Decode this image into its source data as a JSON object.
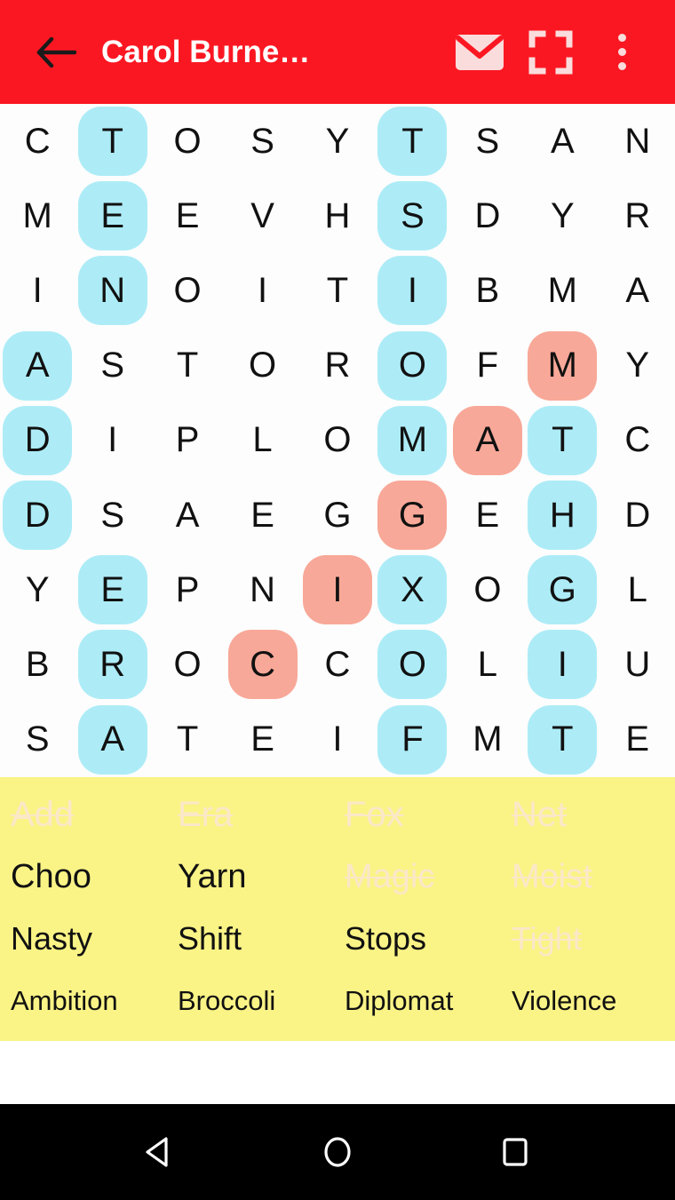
{
  "appbar": {
    "title": "Carol Burne…",
    "back_icon": "arrow-left-icon",
    "mail_icon": "envelope-icon",
    "fullscreen_icon": "fullscreen-icon",
    "overflow_icon": "more-vertical-icon",
    "background_color": "#FB1722",
    "title_color": "#FFFFFF",
    "icon_color": "#FADCDC"
  },
  "grid": {
    "rows": 9,
    "cols": 9,
    "highlight_cyan": "#ADECF7",
    "highlight_pink": "#F8A898",
    "letter_color": "#111111",
    "letters": [
      [
        "C",
        "T",
        "O",
        "S",
        "Y",
        "T",
        "S",
        "A",
        "N"
      ],
      [
        "M",
        "E",
        "E",
        "V",
        "H",
        "S",
        "D",
        "Y",
        "R"
      ],
      [
        "I",
        "N",
        "O",
        "I",
        "T",
        "I",
        "B",
        "M",
        "A"
      ],
      [
        "A",
        "S",
        "T",
        "O",
        "R",
        "O",
        "F",
        "M",
        "Y"
      ],
      [
        "D",
        "I",
        "P",
        "L",
        "O",
        "M",
        "A",
        "T",
        "C"
      ],
      [
        "D",
        "S",
        "A",
        "E",
        "G",
        "G",
        "E",
        "H",
        "D"
      ],
      [
        "Y",
        "E",
        "P",
        "N",
        "I",
        "X",
        "O",
        "G",
        "L"
      ],
      [
        "B",
        "R",
        "O",
        "C",
        "C",
        "O",
        "L",
        "I",
        "U"
      ],
      [
        "S",
        "A",
        "T",
        "E",
        "I",
        "F",
        "M",
        "T",
        "E"
      ]
    ],
    "highlights": [
      [
        "none",
        "cyan",
        "none",
        "none",
        "none",
        "cyan",
        "none",
        "none",
        "none"
      ],
      [
        "none",
        "cyan",
        "none",
        "none",
        "none",
        "cyan",
        "none",
        "none",
        "none"
      ],
      [
        "none",
        "cyan",
        "none",
        "none",
        "none",
        "cyan",
        "none",
        "none",
        "none"
      ],
      [
        "cyan",
        "none",
        "none",
        "none",
        "none",
        "cyan",
        "none",
        "pink",
        "none"
      ],
      [
        "cyan",
        "none",
        "none",
        "none",
        "none",
        "cyan",
        "pink",
        "cyan",
        "none"
      ],
      [
        "cyan",
        "none",
        "none",
        "none",
        "none",
        "pink",
        "none",
        "cyan",
        "none"
      ],
      [
        "none",
        "cyan",
        "none",
        "none",
        "pink",
        "cyan",
        "none",
        "cyan",
        "none"
      ],
      [
        "none",
        "cyan",
        "none",
        "pink",
        "none",
        "cyan",
        "none",
        "cyan",
        "none"
      ],
      [
        "none",
        "cyan",
        "none",
        "none",
        "none",
        "cyan",
        "none",
        "cyan",
        "none"
      ]
    ]
  },
  "wordlist": {
    "background_color": "#FAF386",
    "found_color": "#FBE8C8",
    "pending_color": "#111111",
    "words": [
      {
        "label": "Add",
        "found": true
      },
      {
        "label": "Era",
        "found": true
      },
      {
        "label": "Fox",
        "found": true
      },
      {
        "label": "Net",
        "found": true
      },
      {
        "label": "Choo",
        "found": false
      },
      {
        "label": "Yarn",
        "found": false
      },
      {
        "label": "Magic",
        "found": true
      },
      {
        "label": "Moist",
        "found": true
      },
      {
        "label": "Nasty",
        "found": false
      },
      {
        "label": "Shift",
        "found": false
      },
      {
        "label": "Stops",
        "found": false
      },
      {
        "label": "Tight",
        "found": true
      },
      {
        "label": "Ambition",
        "found": false
      },
      {
        "label": "Broccoli",
        "found": false
      },
      {
        "label": "Diplomat",
        "found": false
      },
      {
        "label": "Violence",
        "found": false
      }
    ]
  },
  "navbar": {
    "background_color": "#000000",
    "back_icon": "triangle-back-icon",
    "home_icon": "circle-home-icon",
    "recents_icon": "square-recents-icon"
  }
}
